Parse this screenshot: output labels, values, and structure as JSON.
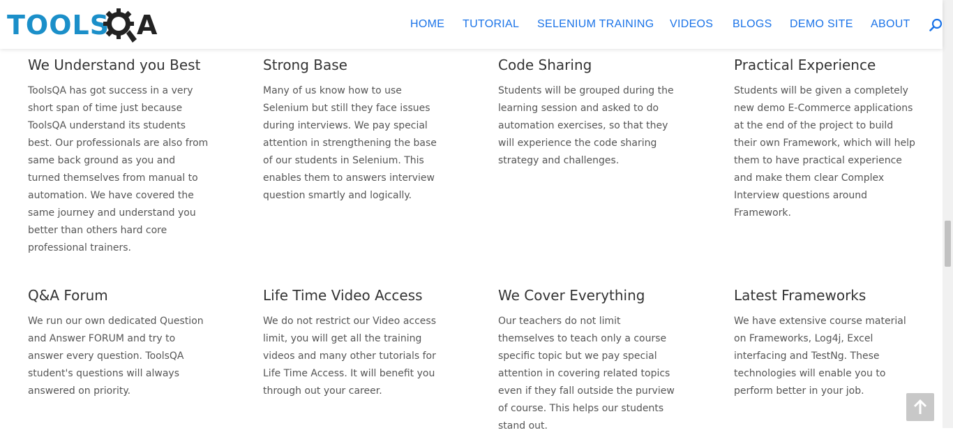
{
  "brand": {
    "logo_text": "TOOLSQA",
    "logo_text_main": "TOOLS",
    "logo_text_end": "A",
    "colors": {
      "logo_blue": "#1b8fc9",
      "logo_dark": "#222222",
      "nav_blue": "#1a73e8"
    }
  },
  "nav": {
    "items": [
      "HOME",
      "TUTORIAL",
      "SELENIUM TRAINING",
      "VIDEOS",
      "BLOGS",
      "DEMO SITE",
      "ABOUT"
    ],
    "search_icon": "search-icon"
  },
  "features": [
    {
      "title": "We Understand you Best",
      "text": "ToolsQA has got success in a very short span of time just because ToolsQA understand its students best. Our professionals are also from same back ground as you and turned themselves from manual to automation. We have covered the same journey and understand you better than others hard core professional trainers."
    },
    {
      "title": "Strong Base",
      "text": "Many of us know how to use Selenium but still they face issues during interviews. We pay special attention in strengthening the base of our students in Selenium. This enables them to answers interview question smartly and logically."
    },
    {
      "title": "Code Sharing",
      "text": "Students will be grouped during the learning session and asked to do automation exercises, so that they will experience the code sharing strategy and challenges."
    },
    {
      "title": "Practical Experience",
      "text": "Students will be given a completely new demo E-Commerce applications at the end of the project to build their own Framework, which will help them to have practical experience and make them clear Complex Interview questions around Framework."
    },
    {
      "title": "Q&A Forum",
      "text": "We run our own dedicated Question and Answer FORUM and try to answer every question. ToolsQA student's questions will always answered on priority."
    },
    {
      "title": "Life Time Video Access",
      "text": "We do not restrict our Video access limit, you will get all the training videos and many other tutorials for Life Time Access. It will benefit you through out your career."
    },
    {
      "title": "We Cover Everything",
      "text": "Our teachers do not limit themselves to teach only a course specific topic but we pay special attention in covering related topics even if they fall outside the purview of course. This helps our students stand out."
    },
    {
      "title": "Latest Frameworks",
      "text": "We have extensive course material on Frameworks, Log4j, Excel interfacing and TestNg. These technologies will enable you to perform better in your job."
    }
  ],
  "back_to_top_icon": "arrow-up-icon"
}
